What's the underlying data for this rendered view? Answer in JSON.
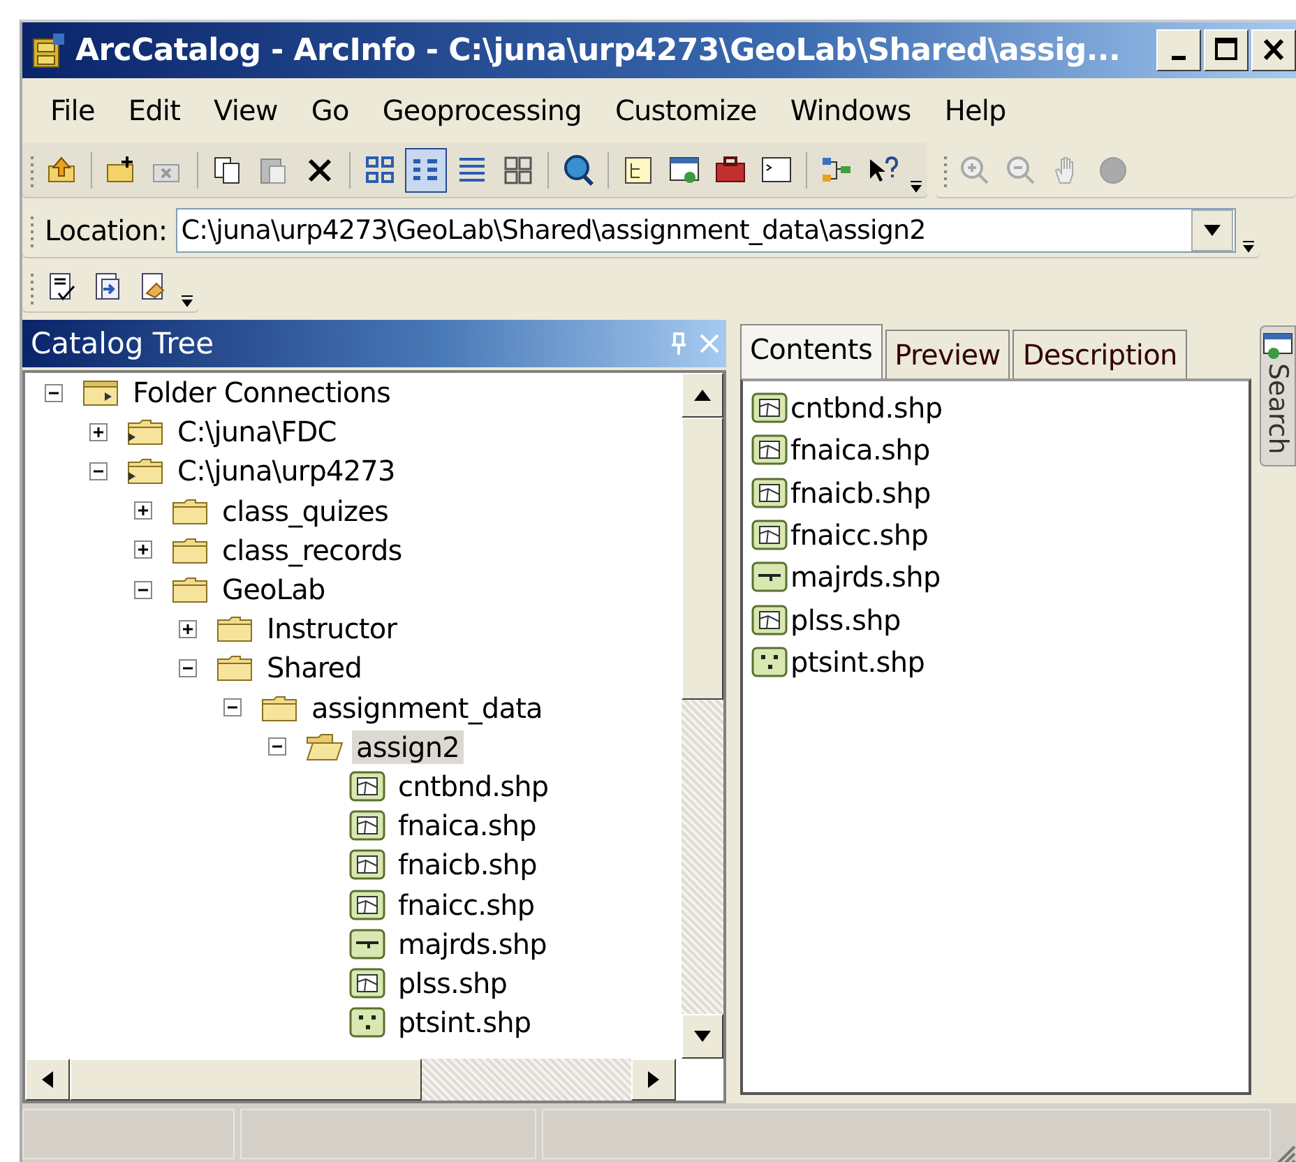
{
  "window": {
    "title": "ArcCatalog - ArcInfo - C:\\juna\\urp4273\\GeoLab\\Shared\\assig..."
  },
  "menu": [
    {
      "label": "File"
    },
    {
      "label": "Edit"
    },
    {
      "label": "View"
    },
    {
      "label": "Go"
    },
    {
      "label": "Geoprocessing"
    },
    {
      "label": "Customize"
    },
    {
      "label": "Windows"
    },
    {
      "label": "Help"
    }
  ],
  "location": {
    "label": "Location:",
    "value": "C:\\juna\\urp4273\\GeoLab\\Shared\\assignment_data\\assign2"
  },
  "catalog_tree": {
    "title": "Catalog Tree",
    "items": [
      {
        "label": "Folder Connections",
        "kind": "connections",
        "expanded": true,
        "selected": false,
        "children": [
          {
            "label": "C:\\juna\\FDC",
            "kind": "connection",
            "expanded": false,
            "selected": false
          },
          {
            "label": "C:\\juna\\urp4273",
            "kind": "connection",
            "expanded": true,
            "selected": false,
            "children": [
              {
                "label": "class_quizes",
                "kind": "folder",
                "expanded": false,
                "selected": false
              },
              {
                "label": "class_records",
                "kind": "folder",
                "expanded": false,
                "selected": false
              },
              {
                "label": "GeoLab",
                "kind": "folder",
                "expanded": true,
                "selected": false,
                "children": [
                  {
                    "label": "Instructor",
                    "kind": "folder",
                    "expanded": false,
                    "selected": false
                  },
                  {
                    "label": "Shared",
                    "kind": "folder",
                    "expanded": true,
                    "selected": false,
                    "children": [
                      {
                        "label": "assignment_data",
                        "kind": "folder",
                        "expanded": true,
                        "selected": false,
                        "children": [
                          {
                            "label": "assign2",
                            "kind": "folder",
                            "expanded": true,
                            "selected": true,
                            "children": [
                              {
                                "label": "cntbnd.shp",
                                "kind": "polygon",
                                "selected": false
                              },
                              {
                                "label": "fnaica.shp",
                                "kind": "polygon",
                                "selected": false
                              },
                              {
                                "label": "fnaicb.shp",
                                "kind": "polygon",
                                "selected": false
                              },
                              {
                                "label": "fnaicc.shp",
                                "kind": "polygon",
                                "selected": false
                              },
                              {
                                "label": "majrds.shp",
                                "kind": "line",
                                "selected": false
                              },
                              {
                                "label": "plss.shp",
                                "kind": "polygon",
                                "selected": false
                              },
                              {
                                "label": "ptsint.shp",
                                "kind": "point",
                                "selected": false
                              }
                            ]
                          }
                        ]
                      }
                    ]
                  }
                ]
              }
            ]
          }
        ]
      }
    ]
  },
  "tabs": [
    {
      "label": "Contents",
      "selected": true
    },
    {
      "label": "Preview",
      "selected": false
    },
    {
      "label": "Description",
      "selected": false
    }
  ],
  "contents": [
    {
      "label": "cntbnd.shp",
      "kind": "polygon"
    },
    {
      "label": "fnaica.shp",
      "kind": "polygon"
    },
    {
      "label": "fnaicb.shp",
      "kind": "polygon"
    },
    {
      "label": "fnaicc.shp",
      "kind": "polygon"
    },
    {
      "label": "majrds.shp",
      "kind": "line"
    },
    {
      "label": "plss.shp",
      "kind": "polygon"
    },
    {
      "label": "ptsint.shp",
      "kind": "point"
    }
  ],
  "side_tab": {
    "label": "Search"
  }
}
